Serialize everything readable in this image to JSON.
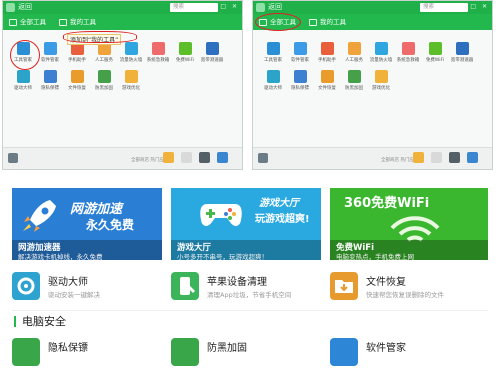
{
  "left_window": {
    "back_label": "返回",
    "tabs": [
      {
        "label": "全部工具"
      },
      {
        "label": "我的工具"
      }
    ],
    "search_placeholder": "搜索",
    "annotation": "添加到“我的工具”",
    "apps": [
      {
        "label": "工具管家",
        "color": "#2b8fd6"
      },
      {
        "label": "软件管家",
        "color": "#3c9be6"
      },
      {
        "label": "手机助手",
        "color": "#e95f3b"
      },
      {
        "label": "人工服务",
        "color": "#f0a33a"
      },
      {
        "label": "流量防火墙",
        "color": "#2fa6e0"
      },
      {
        "label": "系统急救箱",
        "color": "#ef6b6b"
      },
      {
        "label": "免费WiFi",
        "color": "#5cbf2a"
      },
      {
        "label": "宽带测速器",
        "color": "#2f6fbf"
      },
      {
        "label": "驱动大师",
        "color": "#2ca4c9"
      },
      {
        "label": "隐私保镖",
        "color": "#3d7fd1"
      },
      {
        "label": "文件恢复",
        "color": "#e99b2c"
      },
      {
        "label": "防黑加固",
        "color": "#45a049"
      },
      {
        "label": "游戏优化",
        "color": "#f1b23b"
      }
    ],
    "bottom_text": "全部商店 热门应用",
    "bottom_icons": [
      {
        "color": "#f1b23b"
      },
      {
        "color": "#d9d9d9"
      },
      {
        "color": "#555f66"
      },
      {
        "color": "#3b86d0"
      }
    ]
  },
  "right_window": {
    "back_label": "返回",
    "tabs": [
      {
        "label": "全部工具"
      },
      {
        "label": "我的工具"
      }
    ],
    "search_placeholder": "搜索",
    "apps": [
      {
        "label": "工具管家",
        "color": "#2b8fd6"
      },
      {
        "label": "软件管家",
        "color": "#3c9be6"
      },
      {
        "label": "手机助手",
        "color": "#e95f3b"
      },
      {
        "label": "人工服务",
        "color": "#f0a33a"
      },
      {
        "label": "流量防火墙",
        "color": "#2fa6e0"
      },
      {
        "label": "系统急救箱",
        "color": "#ef6b6b"
      },
      {
        "label": "免费WiFi",
        "color": "#5cbf2a"
      },
      {
        "label": "宽带测速器",
        "color": "#2f6fbf"
      },
      {
        "label": "驱动大师",
        "color": "#2ca4c9"
      },
      {
        "label": "隐私保镖",
        "color": "#3d7fd1"
      },
      {
        "label": "文件恢复",
        "color": "#e99b2c"
      },
      {
        "label": "防黑加固",
        "color": "#45a049"
      },
      {
        "label": "游戏优化",
        "color": "#f1b23b"
      }
    ],
    "bottom_text": "全部商店 热门应用",
    "bottom_icons": [
      {
        "color": "#f1b23b"
      },
      {
        "color": "#d9d9d9"
      },
      {
        "color": "#555f66"
      },
      {
        "color": "#3b86d0"
      }
    ]
  },
  "banners": [
    {
      "headline": "网游加速",
      "subline": "永久免费",
      "name": "网游加速器",
      "desc": "解决游戏卡机掉线，永久免费",
      "color": "#2a7fd4"
    },
    {
      "headline": "游戏大厅",
      "subline": "玩游戏超爽!",
      "name": "游戏大厅",
      "desc": "小号多开不串号，玩游戏超爽！",
      "color": "#29a9e0"
    },
    {
      "headline": "360免费WiFi",
      "subline": "",
      "name": "免费WiFi",
      "desc": "电脑变热点，手机免费上网",
      "color": "#3bb62f"
    }
  ],
  "features_row1": [
    {
      "name": "驱动大师",
      "desc": "驱动安装一键解决",
      "color": "#2ea3cf"
    },
    {
      "name": "苹果设备清理",
      "desc": "清理App垃圾，节省手机空间",
      "color": "#3cb55a"
    },
    {
      "name": "文件恢复",
      "desc": "快速帮您恢复误删除的文件",
      "color": "#e79a2e"
    }
  ],
  "section_title": "电脑安全",
  "features_row2": [
    {
      "name": "隐私保镖",
      "color": "#3aa64a"
    },
    {
      "name": "防黑加固",
      "color": "#3aa64a"
    },
    {
      "name": "软件管家",
      "color": "#2d86d6"
    }
  ],
  "colors": {
    "brand_green": "#23b84e",
    "annotation_red": "#d22222"
  }
}
